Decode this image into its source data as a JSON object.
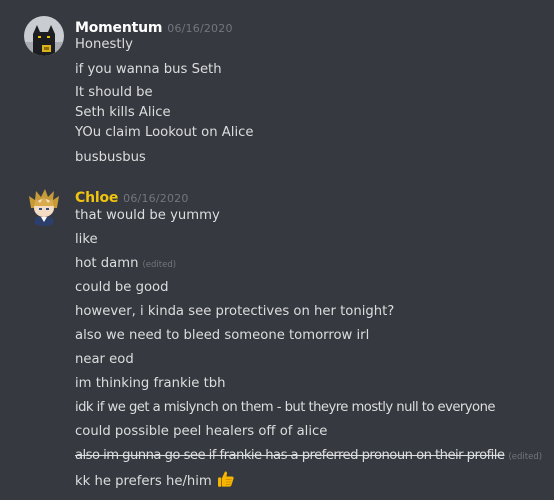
{
  "groups": [
    {
      "username": "Momentum",
      "username_color": "#ffffff",
      "timestamp": "06/16/2020",
      "avatar_icon": "dark-cat-avatar-icon",
      "messages": [
        {
          "text": "Honestly"
        },
        {
          "text": "if you wanna bus Seth"
        },
        {
          "text": "It should be"
        },
        {
          "text": "Seth kills Alice"
        },
        {
          "text": "YOu claim Lookout on Alice"
        },
        {
          "text": "busbusbus"
        }
      ]
    },
    {
      "username": "Chloe",
      "username_color": "#f1c40f",
      "timestamp": "06/16/2020",
      "avatar_icon": "anime-character-avatar-icon",
      "messages": [
        {
          "text": "that would be yummy"
        },
        {
          "text": "like"
        },
        {
          "text": "hot damn",
          "edited": "(edited)"
        },
        {
          "text": "could be good"
        },
        {
          "text": "however, i kinda see protectives on her tonight?"
        },
        {
          "text": "also we need to bleed someone tomorrow irl"
        },
        {
          "text": "near eod"
        },
        {
          "text": "im thinking frankie tbh"
        },
        {
          "text": "idk if we get a mislynch on them - but theyre mostly null to everyone"
        },
        {
          "text": "could possible peel healers off of alice"
        },
        {
          "text": "also im gunna go see if frankie has a preferred pronoun on their profile",
          "edited": "(edited)",
          "strikethrough": true
        },
        {
          "text": "kk he prefers he/him",
          "emoji": "thumbs-up-icon"
        }
      ]
    }
  ]
}
